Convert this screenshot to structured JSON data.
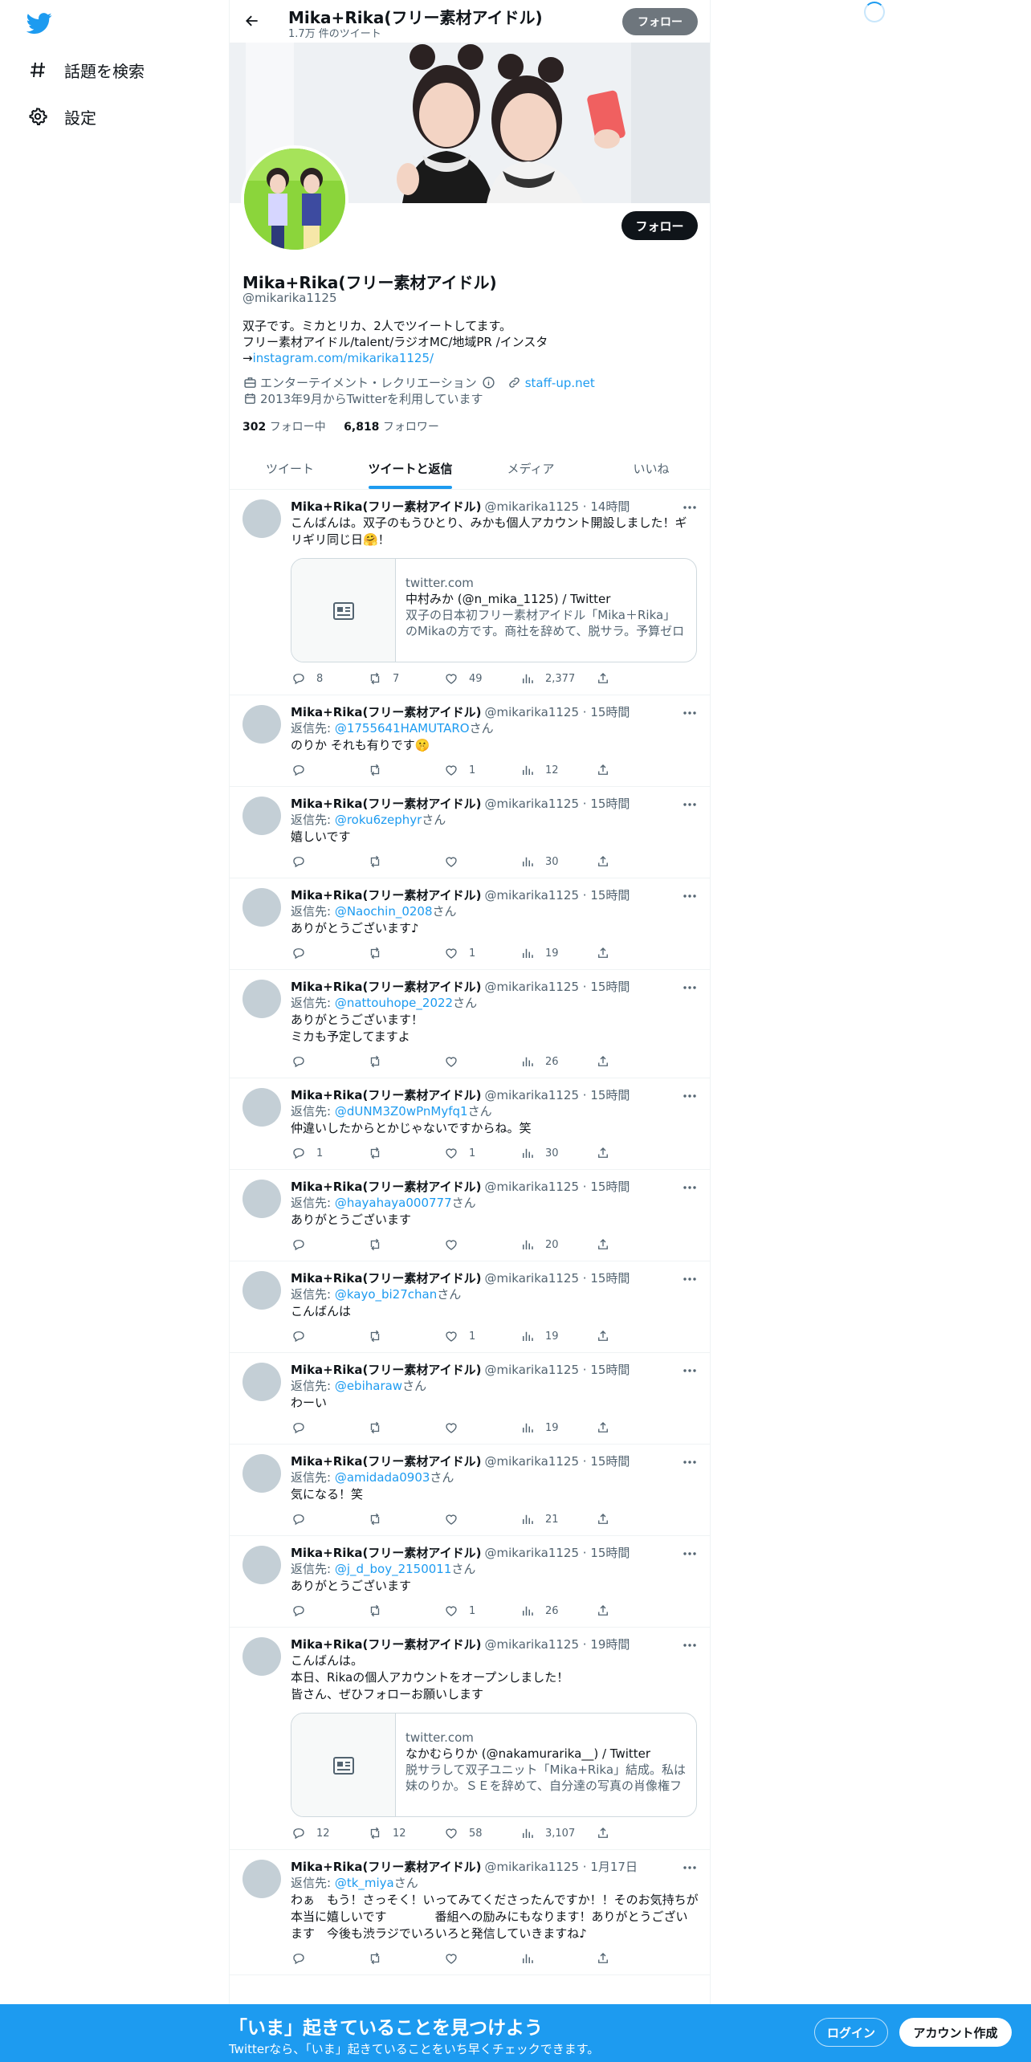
{
  "sidebar": {
    "items": [
      {
        "label": "話題を検索",
        "icon": "hashtag-icon"
      },
      {
        "label": "設定",
        "icon": "gear-icon"
      }
    ]
  },
  "header": {
    "title": "Mika+Rika(フリー素材アイドル)",
    "subtitle": "1.7万 件のツイート",
    "follow_label": "フォロー"
  },
  "profile": {
    "name": "Mika+Rika(フリー素材アイドル)",
    "handle": "@mikarika1125",
    "follow_label": "フォロー",
    "bio_line1": "双子です。ミカとリカ、2人でツイートしてます。",
    "bio_line2": "フリー素材アイドル/talent/ラジオMC/地域PR /インスタ",
    "bio_prefix": "→",
    "bio_link": "instagram.com/mikarika1125/",
    "category": "エンターテイメント・レクリエーション",
    "website": "staff-up.net",
    "joined": "2013年9月からTwitterを利用しています",
    "following_count": "302",
    "following_label": "フォロー中",
    "followers_count": "6,818",
    "followers_label": "フォロワー"
  },
  "tabs": [
    "ツイート",
    "ツイートと返信",
    "メディア",
    "いいね"
  ],
  "active_tab": "ツイートと返信",
  "tweets": [
    {
      "name": "Mika+Rika(フリー素材アイドル)",
      "handle": "@mikarika1125",
      "time": "14時間",
      "reply_prefix": "",
      "reply_to": "",
      "reply_suffix": "",
      "text": "こんばんは。双子のもうひとり、みかも個人アカウント開設しました！ギリギリ同じ日🤗！",
      "card": {
        "domain": "twitter.com",
        "title": "中村みか (@n_mika_1125) / Twitter",
        "desc": "双子の日本初フリー素材アイドル「Mika＋Rika」のMikaの方です。商社を辞めて、脱サラ。予算ゼロからWebで活動を広げてきました。"
      },
      "replies": "8",
      "retweets": "7",
      "likes": "49",
      "views": "2,377"
    },
    {
      "name": "Mika+Rika(フリー素材アイドル)",
      "handle": "@mikarika1125",
      "time": "15時間",
      "reply_prefix": "返信先: ",
      "reply_to": "@1755641HAMUTARO",
      "reply_suffix": "さん",
      "text": "のりか それも有りです🤫",
      "replies": "",
      "retweets": "",
      "likes": "1",
      "views": "12"
    },
    {
      "name": "Mika+Rika(フリー素材アイドル)",
      "handle": "@mikarika1125",
      "time": "15時間",
      "reply_prefix": "返信先: ",
      "reply_to": "@roku6zephyr",
      "reply_suffix": "さん",
      "text": "嬉しいです",
      "replies": "",
      "retweets": "",
      "likes": "",
      "views": "30"
    },
    {
      "name": "Mika+Rika(フリー素材アイドル)",
      "handle": "@mikarika1125",
      "time": "15時間",
      "reply_prefix": "返信先: ",
      "reply_to": "@Naochin_0208",
      "reply_suffix": "さん",
      "text": "ありがとうございます♪",
      "replies": "",
      "retweets": "",
      "likes": "1",
      "views": "19"
    },
    {
      "name": "Mika+Rika(フリー素材アイドル)",
      "handle": "@mikarika1125",
      "time": "15時間",
      "reply_prefix": "返信先: ",
      "reply_to": "@nattouhope_2022",
      "reply_suffix": "さん",
      "text": "ありがとうございます！\nミカも予定してますよ",
      "replies": "",
      "retweets": "",
      "likes": "",
      "views": "26"
    },
    {
      "name": "Mika+Rika(フリー素材アイドル)",
      "handle": "@mikarika1125",
      "time": "15時間",
      "reply_prefix": "返信先: ",
      "reply_to": "@dUNM3Z0wPnMyfq1",
      "reply_suffix": "さん",
      "text": "仲違いしたからとかじゃないですからね。笑",
      "replies": "1",
      "retweets": "",
      "likes": "1",
      "views": "30"
    },
    {
      "name": "Mika+Rika(フリー素材アイドル)",
      "handle": "@mikarika1125",
      "time": "15時間",
      "reply_prefix": "返信先: ",
      "reply_to": "@hayahaya000777",
      "reply_suffix": "さん",
      "text": "ありがとうございます",
      "replies": "",
      "retweets": "",
      "likes": "",
      "views": "20"
    },
    {
      "name": "Mika+Rika(フリー素材アイドル)",
      "handle": "@mikarika1125",
      "time": "15時間",
      "reply_prefix": "返信先: ",
      "reply_to": "@kayo_bi27chan",
      "reply_suffix": "さん",
      "text": "こんばんは",
      "replies": "",
      "retweets": "",
      "likes": "1",
      "views": "19"
    },
    {
      "name": "Mika+Rika(フリー素材アイドル)",
      "handle": "@mikarika1125",
      "time": "15時間",
      "reply_prefix": "返信先: ",
      "reply_to": "@ebiharaw",
      "reply_suffix": "さん",
      "text": "わーい",
      "replies": "",
      "retweets": "",
      "likes": "",
      "views": "19"
    },
    {
      "name": "Mika+Rika(フリー素材アイドル)",
      "handle": "@mikarika1125",
      "time": "15時間",
      "reply_prefix": "返信先: ",
      "reply_to": "@amidada0903",
      "reply_suffix": "さん",
      "text": "気になる！笑",
      "replies": "",
      "retweets": "",
      "likes": "",
      "views": "21"
    },
    {
      "name": "Mika+Rika(フリー素材アイドル)",
      "handle": "@mikarika1125",
      "time": "15時間",
      "reply_prefix": "返信先: ",
      "reply_to": "@j_d_boy_2150011",
      "reply_suffix": "さん",
      "text": "ありがとうございます",
      "replies": "",
      "retweets": "",
      "likes": "1",
      "views": "26"
    },
    {
      "name": "Mika+Rika(フリー素材アイドル)",
      "handle": "@mikarika1125",
      "time": "19時間",
      "reply_prefix": "",
      "reply_to": "",
      "reply_suffix": "",
      "text": "こんばんは。\n本日、Rikaの個人アカウントをオープンしました！\n皆さん、ぜひフォローお願いします",
      "card": {
        "domain": "twitter.com",
        "title": "なかむらりか (@nakamurarika__) / Twitter",
        "desc": "脱サラして双子ユニット「Mika+Rika」結成。私は妹のりか。ＳＥを辞めて、自分達の写真の肖像権フリー素材化。"
      },
      "replies": "12",
      "retweets": "12",
      "likes": "58",
      "views": "3,107"
    },
    {
      "name": "Mika+Rika(フリー素材アイドル)",
      "handle": "@mikarika1125",
      "time": "1月17日",
      "reply_prefix": "返信先: ",
      "reply_to": "@tk_miya",
      "reply_suffix": "さん",
      "text": "わぁ　もう！さっそく！いってみてくださったんですか！！そのお気持ちが本当に嬉しいです　　　　番組への励みにもなります！ありがとうございます　今後も渋ラジでいろいろと発信していきますね♪",
      "replies": "",
      "retweets": "",
      "likes": "",
      "views": ""
    }
  ],
  "bottom_bar": {
    "title": "「いま」起きていることを見つけよう",
    "subtitle": "Twitterなら、「いま」起きていることをいち早くチェックできます。",
    "login_label": "ログイン",
    "signup_label": "アカウント作成"
  },
  "colors": {
    "accent": "#1d9bf0",
    "text": "#0f1419",
    "muted": "#536471",
    "border": "#eff3f4"
  }
}
